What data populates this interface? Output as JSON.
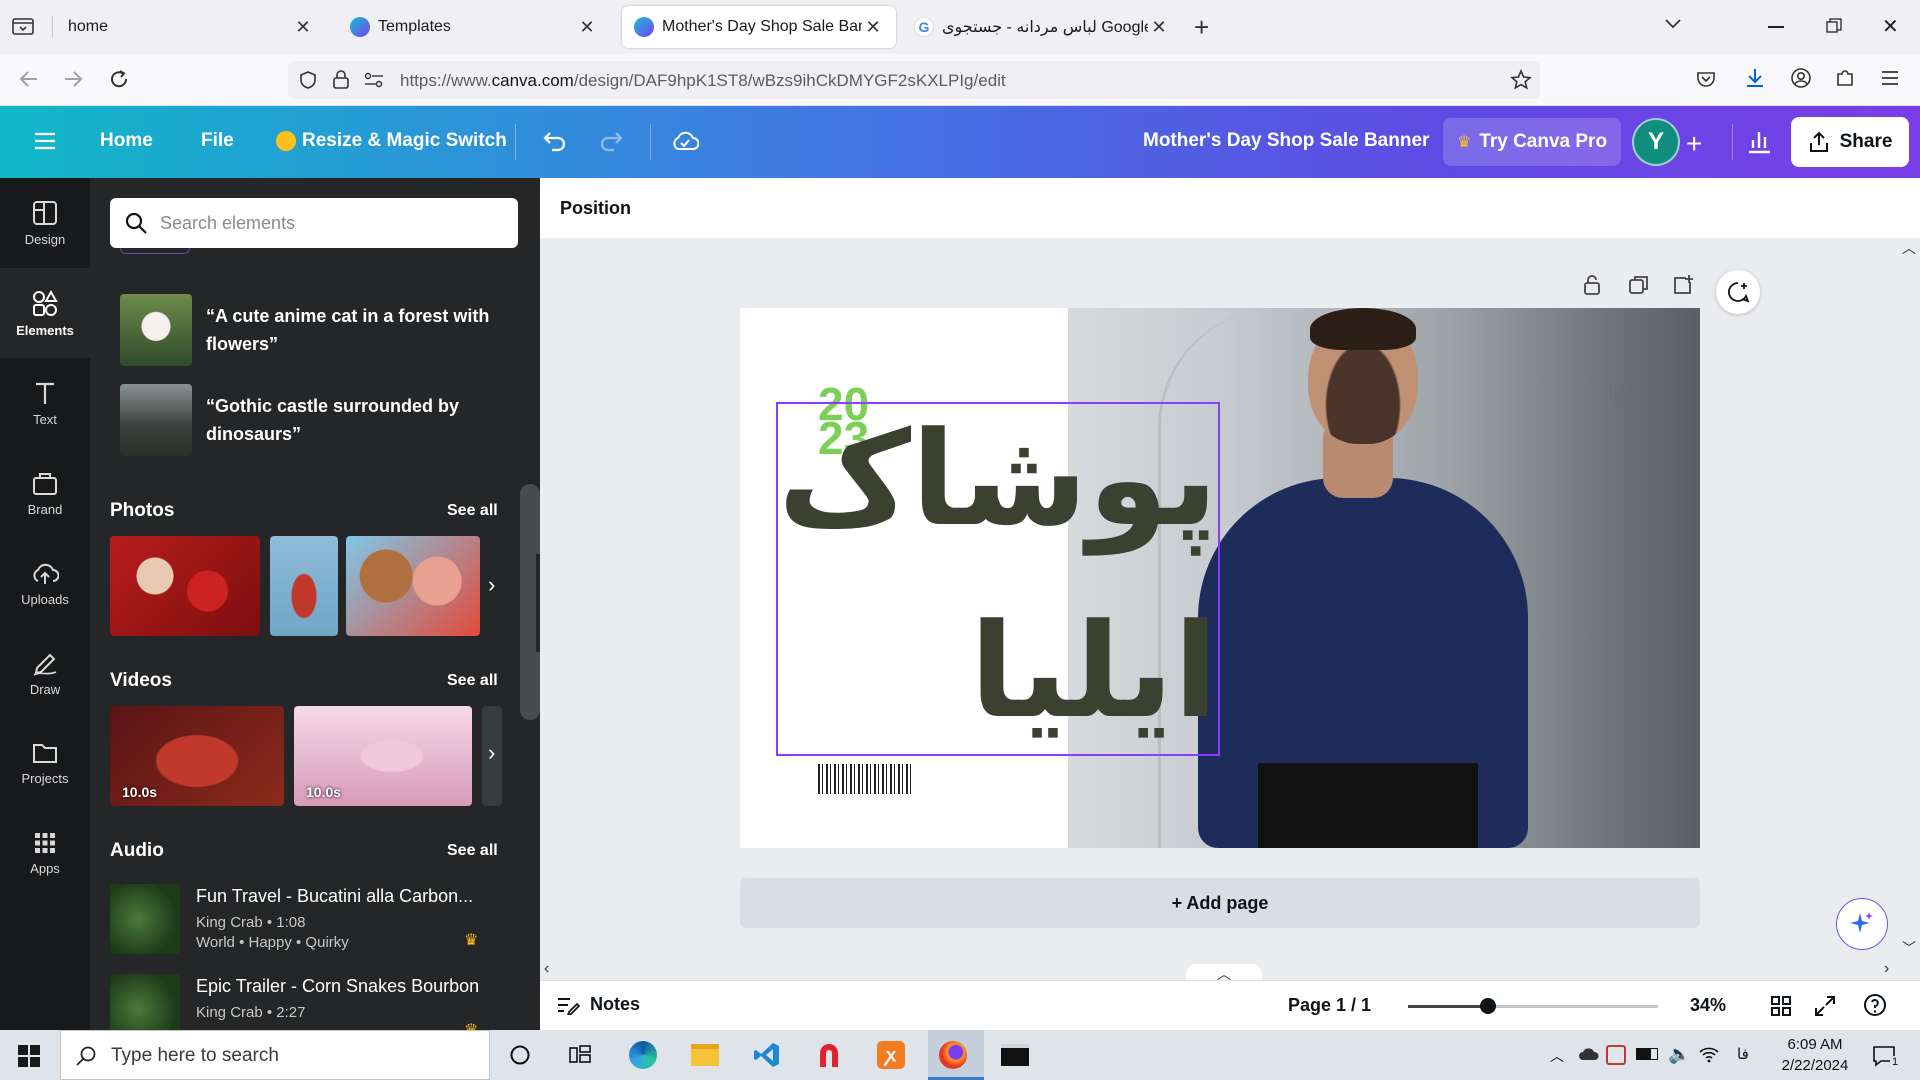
{
  "browser": {
    "tabs": [
      {
        "label": "home"
      },
      {
        "label": "Templates"
      },
      {
        "label": "Mother's Day Shop Sale Banner"
      },
      {
        "label": "لباس مردانه - جستجوی Google"
      }
    ],
    "url_prefix": "https://www.",
    "url_domain": "canva.com",
    "url_path": "/design/DAF9hpK1ST8/wBzs9ihCkDMYGF2sKXLPIg/edit"
  },
  "canva_bar": {
    "home": "Home",
    "file": "File",
    "resize": "Resize & Magic Switch",
    "doc_title": "Mother's Day Shop Sale Banner",
    "try_pro": "Try Canva Pro",
    "avatar_letter": "Y",
    "share": "Share"
  },
  "rail": [
    {
      "label": "Design",
      "icon": "layout-icon"
    },
    {
      "label": "Elements",
      "icon": "shapes-icon"
    },
    {
      "label": "Text",
      "icon": "text-icon"
    },
    {
      "label": "Brand",
      "icon": "brand-icon"
    },
    {
      "label": "Uploads",
      "icon": "upload-cloud-icon"
    },
    {
      "label": "Draw",
      "icon": "pen-icon"
    },
    {
      "label": "Projects",
      "icon": "folder-icon"
    },
    {
      "label": "Apps",
      "icon": "apps-grid-icon"
    }
  ],
  "panel": {
    "search_placeholder": "Search elements",
    "ai_prompts": [
      "“A cute anime cat in a forest with flowers”",
      "“Gothic castle surrounded by dinosaurs”"
    ],
    "photos_title": "Photos",
    "videos_title": "Videos",
    "audio_title": "Audio",
    "see_all": "See all",
    "videos": [
      {
        "duration": "10.0s"
      },
      {
        "duration": "10.0s"
      }
    ],
    "audio": [
      {
        "title": "Fun Travel - Bucatini alla Carbon...",
        "artist": "King Crab • 1:08",
        "tags": "World • Happy • Quirky"
      },
      {
        "title": "Epic Trailer - Corn Snakes Bourbon",
        "artist": "King Crab • 2:27",
        "tags": ""
      }
    ]
  },
  "editor": {
    "position_label": "Position",
    "design": {
      "year_top": "20",
      "year_bottom": "23",
      "title_line1": "پوشاک",
      "title_line2": "ایلیا",
      "watermark": "ایلیا"
    },
    "add_page": "+ Add page",
    "notes": "Notes",
    "page_indicator": "Page 1 / 1",
    "zoom_value": 34,
    "zoom_label": "34%",
    "zoom_fraction": 0.32
  },
  "taskbar": {
    "search_placeholder": "Type here to search",
    "time": "6:09 AM",
    "date": "2/22/2024",
    "lang": "فا",
    "notification_count": "1"
  },
  "colors": {
    "canva_gradient_start": "#10b8c8",
    "canva_gradient_end": "#7a3ee8",
    "selection": "#8b3dff",
    "year_green": "#7cd05a",
    "title_olive": "#3b4030",
    "shirt_navy": "#1e2c5c"
  }
}
